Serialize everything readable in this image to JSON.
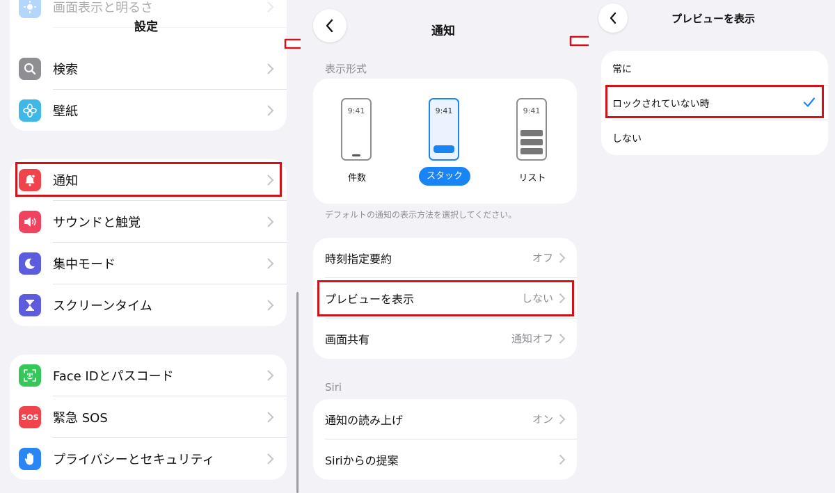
{
  "settings": {
    "title": "設定",
    "top_partial_label": "画面表示と明るさ",
    "items": [
      {
        "label": "検索"
      },
      {
        "label": "壁紙"
      },
      {
        "label": "通知"
      },
      {
        "label": "サウンドと触覚"
      },
      {
        "label": "集中モード"
      },
      {
        "label": "スクリーンタイム"
      },
      {
        "label": "Face IDとパスコード"
      },
      {
        "label": "緊急 SOS",
        "icon_text": "SOS"
      },
      {
        "label": "プライバシーとセキュリティ"
      }
    ]
  },
  "notifications": {
    "title": "通知",
    "display_style_header": "表示形式",
    "styles": [
      {
        "label": "件数",
        "time": "9:41"
      },
      {
        "label": "スタック",
        "time": "9:41",
        "selected": true
      },
      {
        "label": "リスト",
        "time": "9:41"
      }
    ],
    "footnote": "デフォルトの通知の表示方法を選択してください。",
    "rows": [
      {
        "label": "時刻指定要約",
        "value": "オフ"
      },
      {
        "label": "プレビューを表示",
        "value": "しない"
      },
      {
        "label": "画面共有",
        "value": "通知オフ"
      }
    ],
    "siri_header": "Siri",
    "siri_rows": [
      {
        "label": "通知の読み上げ",
        "value": "オン"
      },
      {
        "label": "Siriからの提案"
      }
    ]
  },
  "preview": {
    "title": "プレビューを表示",
    "options": [
      {
        "label": "常に"
      },
      {
        "label": "ロックされていない時",
        "checked": true
      },
      {
        "label": "しない"
      }
    ]
  },
  "colors": {
    "highlight": "#d0121b",
    "accent_blue": "#1a84f5",
    "notif_icon": "#f0434b",
    "sound_icon": "#f0435d",
    "focus_icon": "#5d5cdf",
    "screentime_icon": "#5d5cdf",
    "faceid_icon": "#35c759",
    "sos_icon": "#f0434b",
    "privacy_icon": "#2a86f5",
    "search_icon": "#8e8e93",
    "wallpaper_icon": "#3fb8e8"
  }
}
